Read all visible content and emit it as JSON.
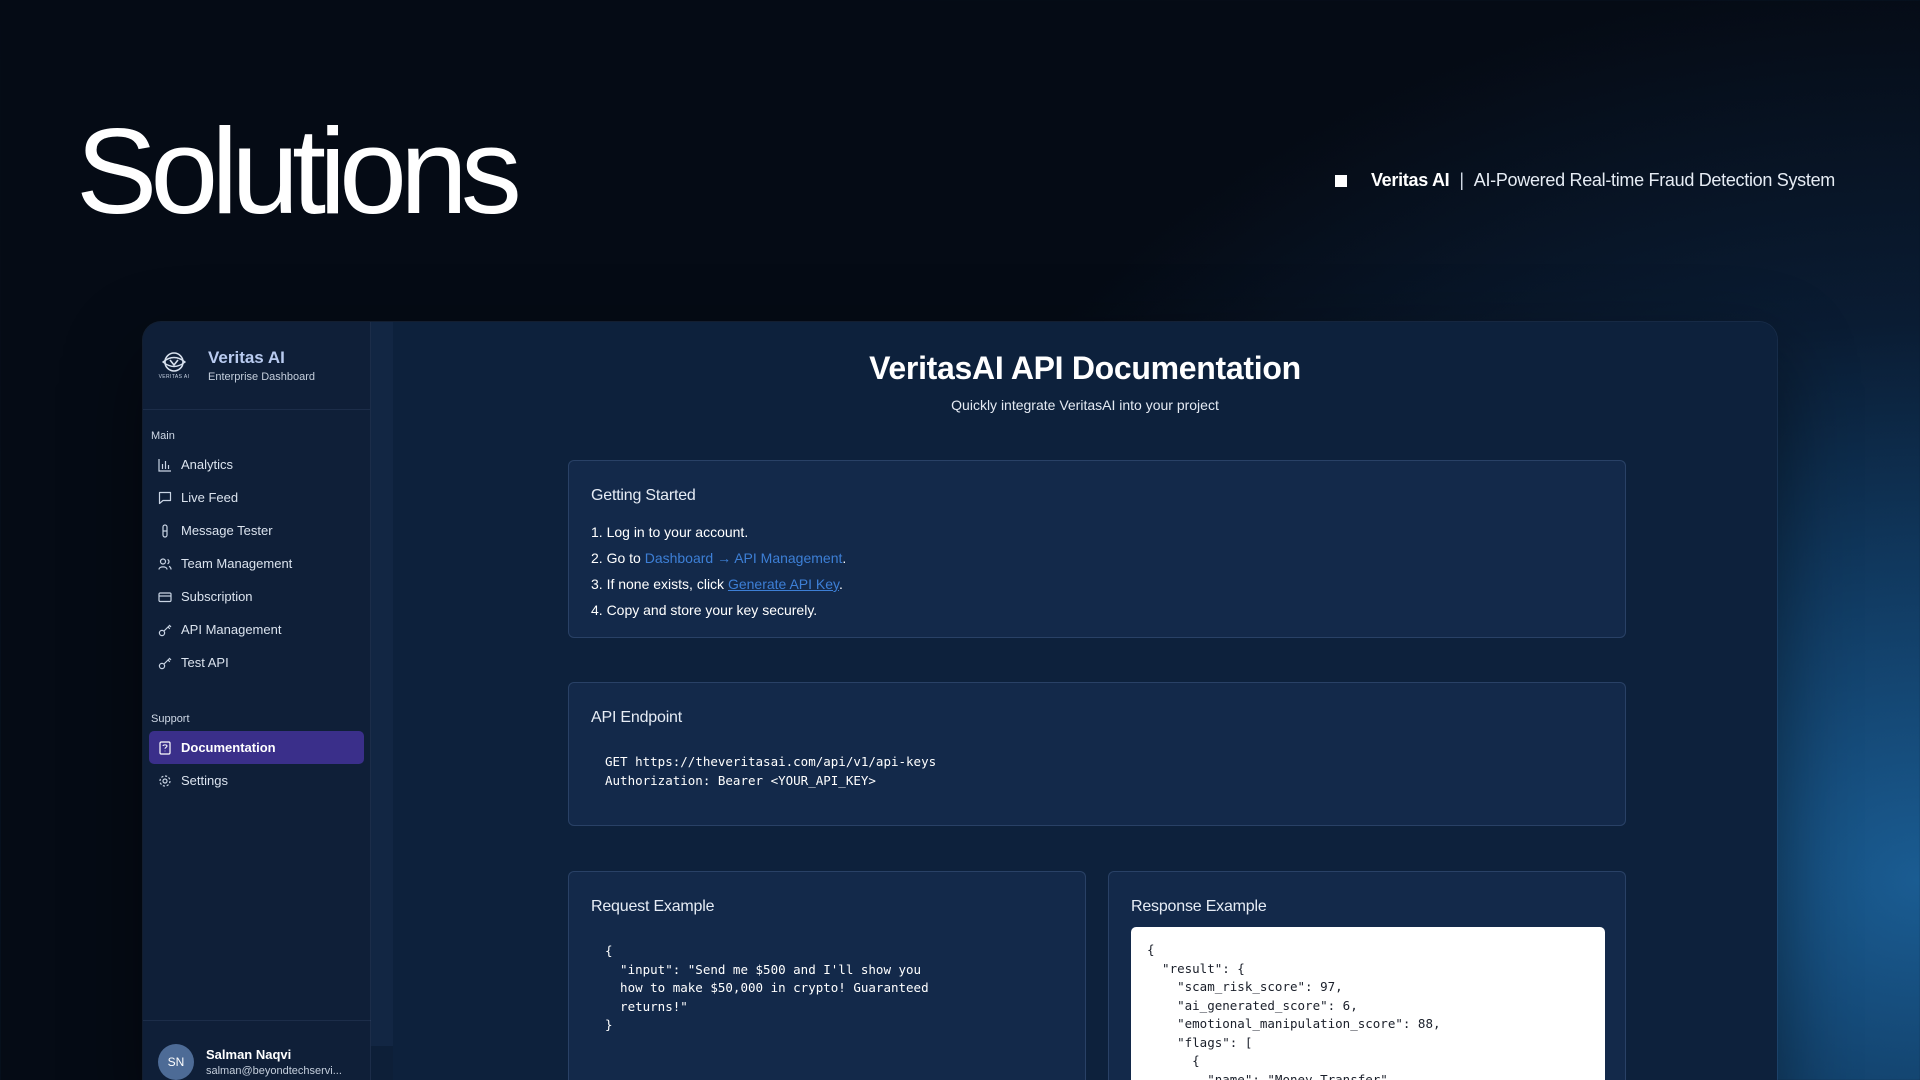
{
  "hero": {
    "title": "Solutions",
    "brand": "Veritas AI",
    "separator": "|",
    "description": "AI-Powered Real-time Fraud Detection System"
  },
  "sidebar": {
    "app_name": "Veritas AI",
    "app_subtitle": "Enterprise Dashboard",
    "logo_text": "VERITAS AI",
    "main_label": "Main",
    "main_items": [
      {
        "label": "Analytics",
        "icon": "bar-chart-icon"
      },
      {
        "label": "Live Feed",
        "icon": "chat-bubble-icon"
      },
      {
        "label": "Message Tester",
        "icon": "test-tube-icon"
      },
      {
        "label": "Team Management",
        "icon": "users-icon"
      },
      {
        "label": "Subscription",
        "icon": "credit-card-icon"
      },
      {
        "label": "API Management",
        "icon": "key-icon"
      },
      {
        "label": "Test API",
        "icon": "key-icon"
      }
    ],
    "support_label": "Support",
    "support_items": [
      {
        "label": "Documentation",
        "icon": "document-icon",
        "active": true
      },
      {
        "label": "Settings",
        "icon": "gear-icon"
      }
    ],
    "user": {
      "initials": "SN",
      "name": "Salman Naqvi",
      "email": "salman@beyondtechservi..."
    }
  },
  "doc": {
    "title": "VeritasAI API Documentation",
    "subtitle": "Quickly integrate VeritasAI into your project",
    "getting_started": {
      "title": "Getting Started",
      "step1": "1. Log in to your account.",
      "step2_prefix": "2. Go to ",
      "step2_link": "Dashboard → API Management",
      "step2_suffix": ".",
      "step3_prefix": "3. If none exists, click ",
      "step3_link": "Generate API Key",
      "step3_suffix": ".",
      "step4": "4. Copy and store your key securely."
    },
    "endpoint": {
      "title": "API Endpoint",
      "code": "GET https://theveritasai.com/api/v1/api-keys\nAuthorization: Bearer <YOUR_API_KEY>"
    },
    "request": {
      "title": "Request Example",
      "code": "{\n  \"input\": \"Send me $500 and I'll show you\n  how to make $50,000 in crypto! Guaranteed\n  returns!\"\n}"
    },
    "response": {
      "title": "Response Example",
      "code": "{\n  \"result\": {\n    \"scam_risk_score\": 97,\n    \"ai_generated_score\": 6,\n    \"emotional_manipulation_score\": 88,\n    \"flags\": [\n      {\n        \"name\": \"Money Transfer\","
    }
  },
  "colors": {
    "accent_active": "#3a2f8a",
    "link": "#3d7fd6",
    "brand_text": "#b9cbf0"
  }
}
